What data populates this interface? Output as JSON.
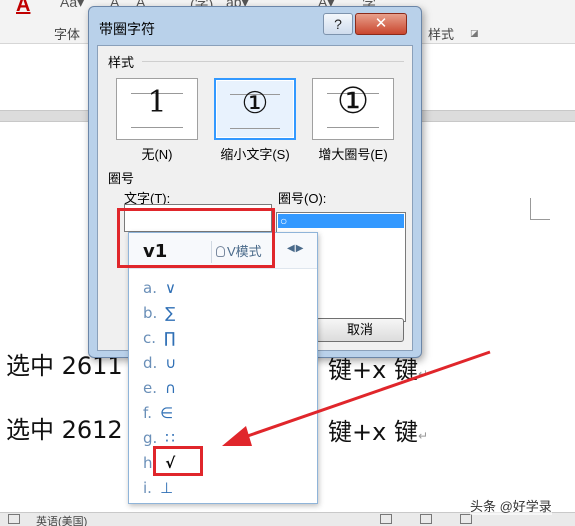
{
  "ribbon": {
    "font_color_glyph": "A",
    "icons": [
      "Aa▾",
      "A",
      "A",
      "(字)",
      "ab▾",
      "A▾",
      "字"
    ],
    "group_font_label": "字体",
    "group_style_label": "样式"
  },
  "dialog": {
    "title": "带圈字符",
    "help_label": "?",
    "close_label": "✕",
    "style_section": "样式",
    "style_options": [
      {
        "glyph": "1",
        "label": "无(N)"
      },
      {
        "glyph": "①",
        "label": "缩小文字(S)"
      },
      {
        "glyph": "①",
        "label": "增大圈号(E)"
      }
    ],
    "enclose_section": "圈号",
    "text_label": "文字(T):",
    "circle_label": "圈号(O):",
    "circle_selected": "○",
    "cancel_label": "取消"
  },
  "ime": {
    "composition": "v1",
    "mode_label": "V模式",
    "nav_arrows": "◀▶",
    "candidates": [
      {
        "key": "a.",
        "symbol": "∨"
      },
      {
        "key": "b.",
        "symbol": "∑"
      },
      {
        "key": "c.",
        "symbol": "∏"
      },
      {
        "key": "d.",
        "symbol": "∪"
      },
      {
        "key": "e.",
        "symbol": "∩"
      },
      {
        "key": "f.",
        "symbol": "∈"
      },
      {
        "key": "g.",
        "symbol": "∷"
      },
      {
        "key": "h.",
        "symbol": "√"
      },
      {
        "key": "i.",
        "symbol": "⊥"
      }
    ]
  },
  "document": {
    "line1_prefix": "选中 2611",
    "line1_suffix": "键+x 键",
    "line2_prefix": "选中 2612",
    "line2_suffix": "键+x 键",
    "para_mark": "↵"
  },
  "statusbar": {
    "language": "英语(美国)"
  },
  "watermark": "头条 @好学录",
  "colors": {
    "annotation_red": "#e0262b",
    "selection_blue": "#3399ff",
    "dialog_frame": "#b9d1ea"
  }
}
